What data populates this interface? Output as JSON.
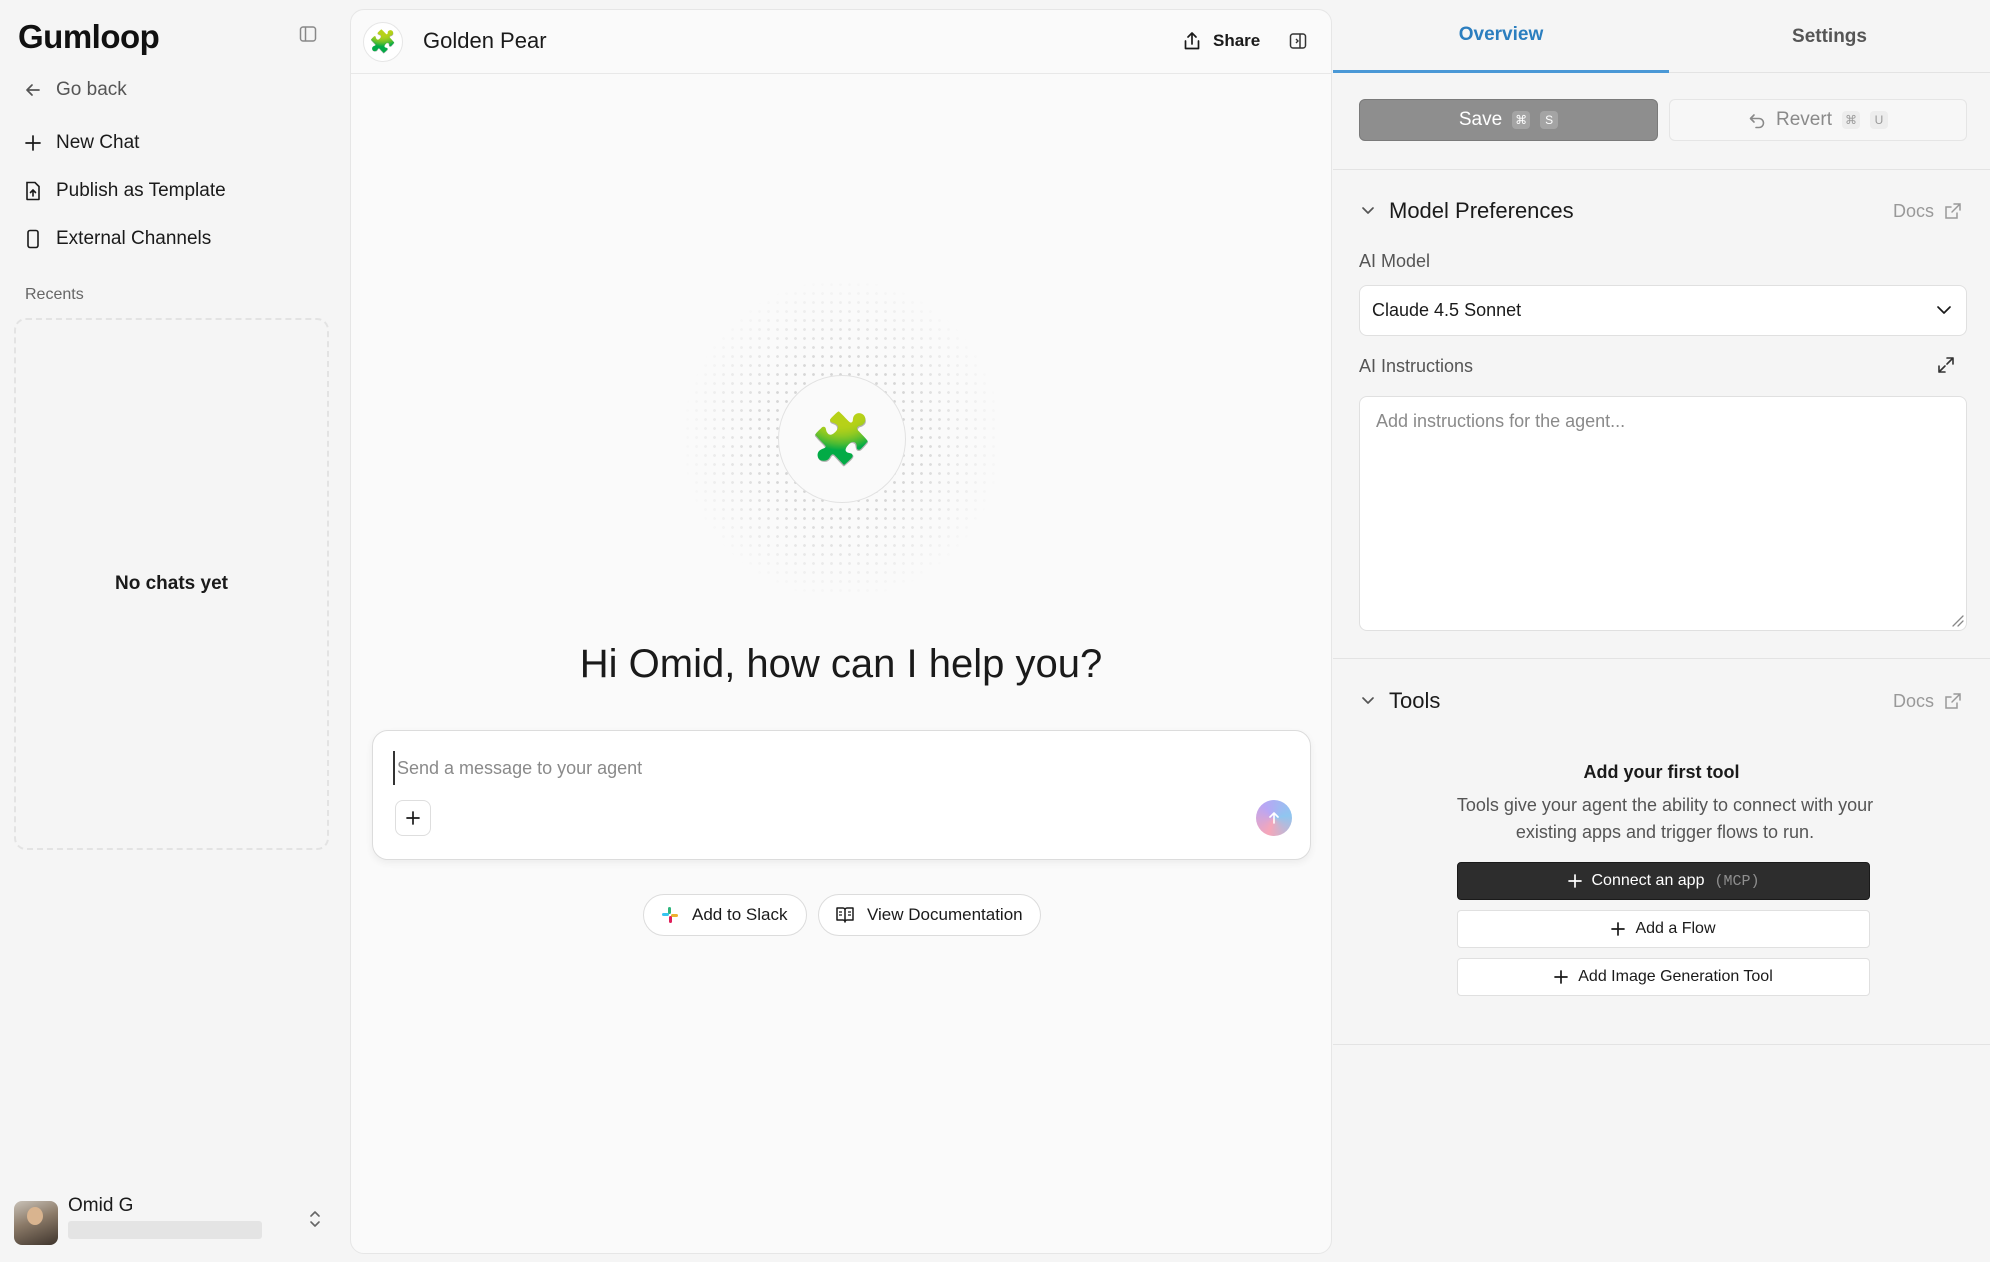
{
  "sidebar": {
    "logo": "Gumloop",
    "go_back": "Go back",
    "new_chat": "New Chat",
    "publish": "Publish as Template",
    "external": "External Channels",
    "recents_label": "Recents",
    "empty_state": "No chats yet",
    "user_name": "Omid G"
  },
  "topbar": {
    "agent_icon": "puzzle-icon",
    "agent_name": "Golden Pear",
    "share_label": "Share"
  },
  "main": {
    "greeting": "Hi Omid, how can I help you?",
    "message_placeholder": "Send a message to your agent",
    "add_to_slack": "Add to Slack",
    "view_docs": "View Documentation"
  },
  "right_panel": {
    "tabs": [
      "Overview",
      "Settings"
    ],
    "active_tab": "Overview",
    "save_label": "Save",
    "save_keys": [
      "⌘",
      "S"
    ],
    "revert_label": "Revert",
    "revert_keys": [
      "⌘",
      "U"
    ],
    "model_section": {
      "title": "Model Preferences",
      "docs": "Docs",
      "ai_model_label": "AI Model",
      "ai_model_value": "Claude 4.5 Sonnet",
      "instructions_label": "AI Instructions",
      "instructions_placeholder": "Add instructions for the agent..."
    },
    "tools_section": {
      "title": "Tools",
      "docs": "Docs",
      "empty_title": "Add your first tool",
      "empty_desc": "Tools give your agent the ability to connect with your existing apps and trigger flows to run.",
      "connect_app": "Connect an app",
      "connect_app_tag": "(MCP)",
      "add_flow": "Add a Flow",
      "add_image_tool": "Add Image Generation Tool"
    }
  },
  "colors": {
    "accent": "#2b7ebf",
    "save_button": "#8e8e8e",
    "dark_button": "#2d2d2d"
  }
}
